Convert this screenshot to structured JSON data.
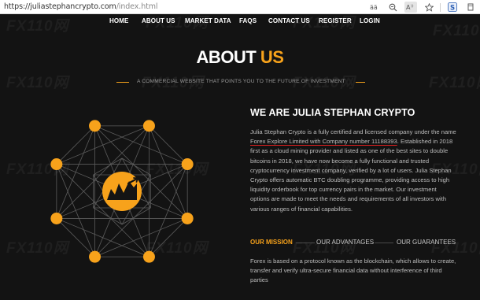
{
  "browser": {
    "url_main": "https://juliastephancrypto.com",
    "url_path": "/index.html",
    "icons": [
      "read-aloud-icon",
      "zoom-icon",
      "read-mode-icon",
      "favorite-icon",
      "extension-icon",
      "more-icon"
    ]
  },
  "nav": {
    "items": [
      "HOME",
      "ABOUT US",
      "MARKET DATA",
      "FAQS",
      "CONTACT US",
      "REGISTER",
      "LOGIN"
    ]
  },
  "watermark": "FX110网",
  "about": {
    "title_part1": "ABOUT ",
    "title_part2": "US",
    "subtitle": "A COMMERCIAL WEBSITE THAT POINTS YOU TO THE FUTURE OF INVESTMENT",
    "heading": "WE ARE JULIA STEPHAN CRYPTO",
    "paragraph_lines": [
      [
        "Julia Stephan Crypto is a fully certified and licensed company under the name"
      ],
      [
        "Forex Explore Limited with Company number 11188393",
        ". Established in 2018"
      ],
      [
        "first as a cloud mining provider and listed as one of the best sites to double"
      ],
      [
        "bitcoins in 2018, we have now become a fully functional and trusted"
      ],
      [
        "cryptocurrency investment company, verified by a lot of users. Julia Stephan"
      ],
      [
        "Crypto offers automatic BTC doubling programme, providing access to high"
      ],
      [
        "liquidity orderbook for top currency pairs in the market. Our investment"
      ],
      [
        "options are made to meet the needs and requirements of all investors with"
      ],
      [
        "various ranges of financial capabilities."
      ]
    ],
    "tabs": [
      "OUR MISSION",
      "OUR ADVANTAGES",
      "OUR GUARANTEES"
    ],
    "mission_lines": [
      "Forex is based on a protocol known as the blockchain, which allows to create,",
      "transfer and verify ultra-secure financial data without interference of third",
      "parties"
    ]
  },
  "colors": {
    "accent": "#f7a21b",
    "background": "#131313",
    "underline": "#e02020"
  }
}
